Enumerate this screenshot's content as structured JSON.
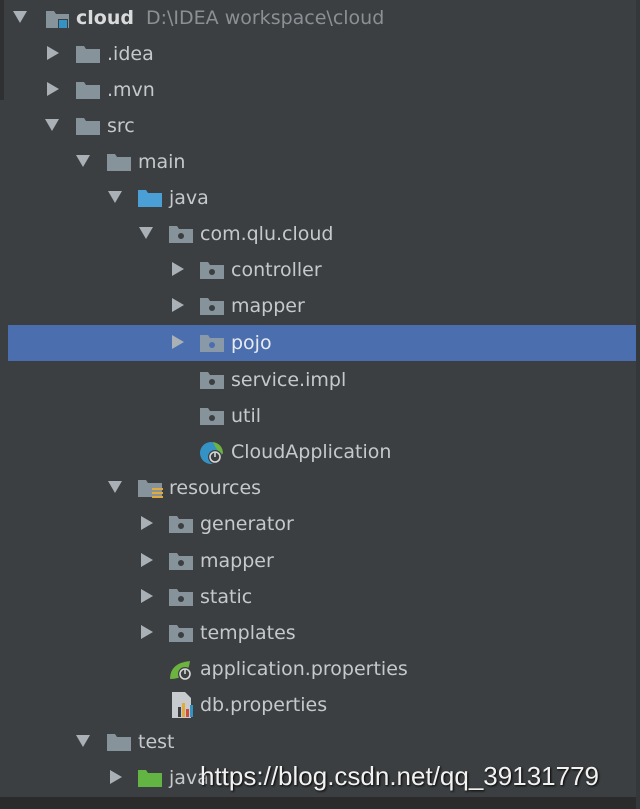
{
  "project": {
    "name": "cloud",
    "path": "D:\\IDEA workspace\\cloud"
  },
  "tree": {
    "idea": ".idea",
    "mvn": ".mvn",
    "src": "src",
    "main": "main",
    "java": "java",
    "package": "com.qlu.cloud",
    "controller": "controller",
    "mapper": "mapper",
    "pojo": "pojo",
    "service_impl": "service.impl",
    "util": "util",
    "cloud_application": "CloudApplication",
    "resources": "resources",
    "generator": "generator",
    "res_mapper": "mapper",
    "static": "static",
    "templates": "templates",
    "application_properties": "application.properties",
    "db_properties": "db.properties",
    "test": "test",
    "test_java": "java"
  },
  "watermark": "https://blog.csdn.net/qq_39131779",
  "colors": {
    "background": "#3c3f41",
    "selection": "#4b6eaf",
    "folder": "#87939a",
    "source_folder": "#4a9fd6",
    "test_folder": "#62b543",
    "spring": "#6db33f"
  },
  "icons": {
    "module": "module-folder-icon",
    "folder": "folder-icon",
    "source_root": "source-root-icon",
    "package": "package-icon",
    "resources_root": "resources-root-icon",
    "spring_boot_class": "spring-boot-class-icon",
    "spring_properties": "spring-properties-icon",
    "properties_file": "properties-file-icon",
    "test_root": "test-root-icon"
  }
}
